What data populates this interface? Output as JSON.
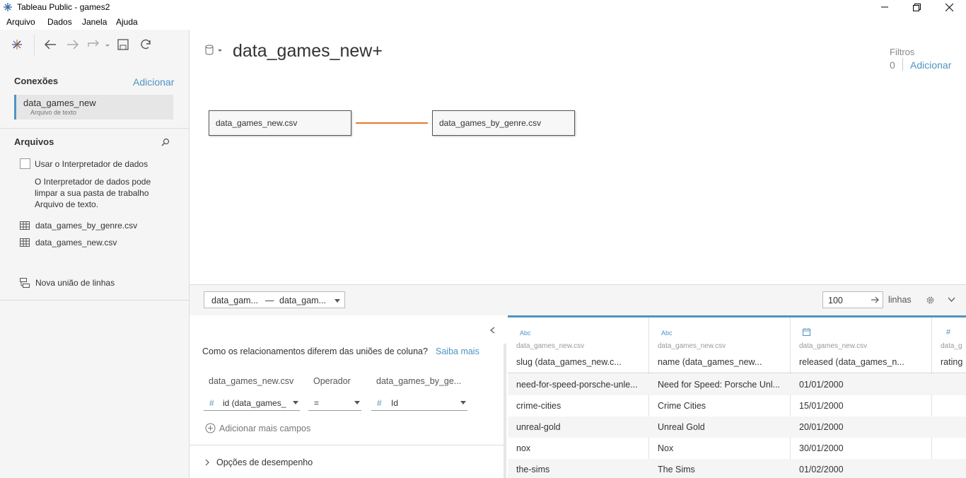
{
  "window": {
    "title": "Tableau Public - games2"
  },
  "menu": [
    "Arquivo",
    "Dados",
    "Janela",
    "Ajuda"
  ],
  "left": {
    "connections_title": "Conexões",
    "add_label": "Adicionar",
    "connection": {
      "name": "data_games_new",
      "type": "Arquivo de texto"
    },
    "files_title": "Arquivos",
    "interpreter_label": "Usar o Interpretador de dados",
    "interpreter_desc": [
      "O Interpretador de dados pode",
      "limpar a sua pasta de trabalho",
      "Arquivo de texto."
    ],
    "files": [
      "data_games_by_genre.csv",
      "data_games_new.csv"
    ],
    "new_union": "Nova união de linhas"
  },
  "canvas": {
    "datasource_title": "data_games_new+",
    "filters_label": "Filtros",
    "filters_count": "0",
    "filters_add": "Adicionar",
    "left_table": "data_games_new.csv",
    "right_table": "data_games_by_genre.csv"
  },
  "lower": {
    "relation_selector": {
      "left": "data_gam...",
      "sep": "—",
      "right": "data_gam..."
    },
    "rows_value": "100",
    "rows_label": "linhas",
    "question": "Como os relacionamentos diferem das uniões de coluna?",
    "learn_more": "Saiba mais",
    "left_source_header": "data_games_new.csv",
    "operator_header": "Operador",
    "right_source_header": "data_games_by_ge...",
    "left_field": "id (data_games_",
    "operator": "=",
    "right_field": "Id",
    "add_fields": "Adicionar mais campos",
    "performance": "Opções de desempenho"
  },
  "grid": {
    "columns": [
      {
        "type": "Abc",
        "source": "data_games_new.csv",
        "name": "slug (data_games_new.c..."
      },
      {
        "type": "Abc",
        "source": "data_games_new.csv",
        "name": "name (data_games_new..."
      },
      {
        "type": "date",
        "source": "data_games_new.csv",
        "name": "released (data_games_n..."
      },
      {
        "type": "#",
        "source": "data_g",
        "name": "rating"
      }
    ],
    "rows": [
      [
        "need-for-speed-porsche-unle...",
        "Need for Speed: Porsche Unl...",
        "01/01/2000",
        ""
      ],
      [
        "crime-cities",
        "Crime Cities",
        "15/01/2000",
        ""
      ],
      [
        "unreal-gold",
        "Unreal Gold",
        "20/01/2000",
        ""
      ],
      [
        "nox",
        "Nox",
        "30/01/2000",
        ""
      ],
      [
        "the-sims",
        "The Sims",
        "01/02/2000",
        ""
      ]
    ]
  }
}
